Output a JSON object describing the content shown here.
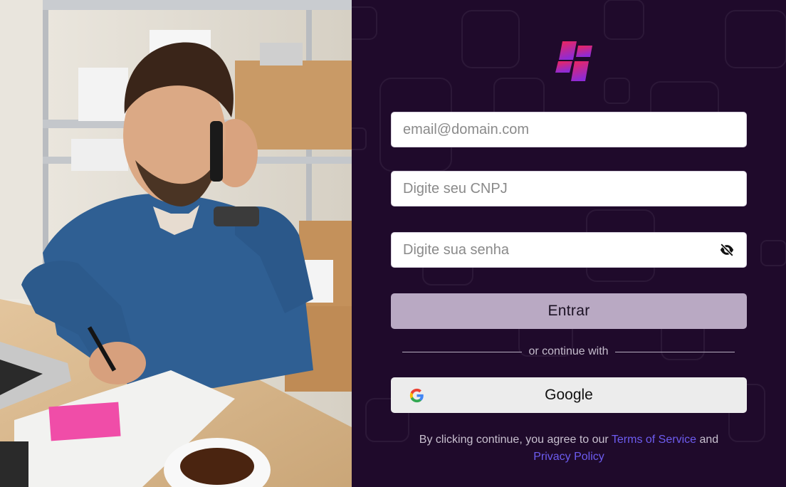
{
  "form": {
    "email_placeholder": "email@domain.com",
    "cnpj_placeholder": "Digite seu CNPJ",
    "password_placeholder": "Digite sua senha",
    "submit_label": "Entrar",
    "divider_text": "or continue with",
    "google_label": "Google"
  },
  "legal": {
    "prefix": "By clicking continue, you agree to our",
    "terms_link": "Terms of Service",
    "conjunction": "and",
    "privacy_link": "Privacy Policy"
  },
  "icons": {
    "brand": "brand-logo-icon",
    "password_toggle": "eye-off-icon",
    "google": "google-g-icon"
  },
  "colors": {
    "panel_bg": "#1f0a2b",
    "submit_bg": "#b9a9c3",
    "link": "#6d5cf0",
    "logo_top": "#f0255a",
    "logo_bottom": "#8e2bd6"
  }
}
